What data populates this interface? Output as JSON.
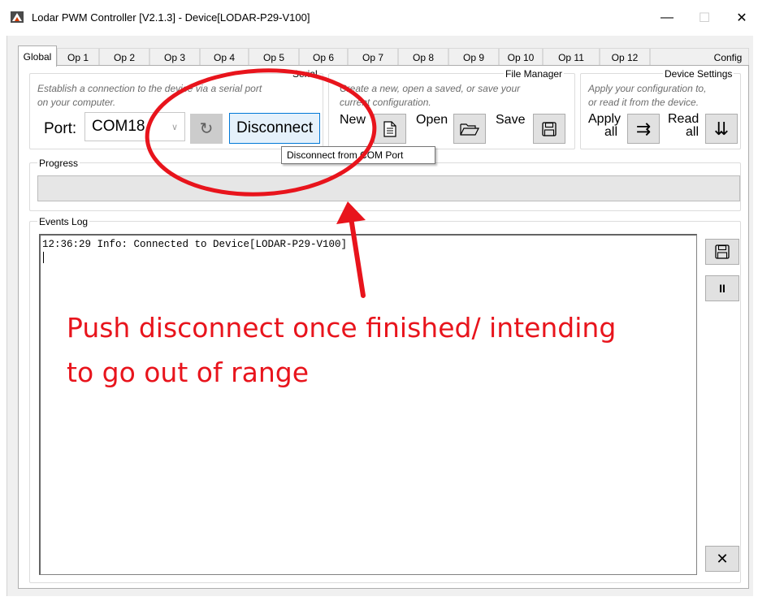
{
  "window": {
    "title": "Lodar PWM Controller [V2.1.3] - Device[LODAR-P29-V100]",
    "controls": {
      "minimize": "—",
      "maximize": "☐",
      "close": "✕"
    }
  },
  "tabs": [
    {
      "label": "Global",
      "active": true
    },
    {
      "label": "Op 1"
    },
    {
      "label": "Op 2"
    },
    {
      "label": "Op 3"
    },
    {
      "label": "Op 4"
    },
    {
      "label": "Op 5"
    },
    {
      "label": "Op 6"
    },
    {
      "label": "Op 7"
    },
    {
      "label": "Op 8"
    },
    {
      "label": "Op 9"
    },
    {
      "label": "Op 10"
    },
    {
      "label": "Op 11"
    },
    {
      "label": "Op 12"
    },
    {
      "label": "Config"
    }
  ],
  "serial": {
    "title": "Serial",
    "hint_line1": "Establish a connection to the device via a serial port",
    "hint_line2": "on your computer.",
    "port_label": "Port:",
    "port_value": "COM18",
    "refresh_glyph": "↻",
    "disconnect_label": "Disconnect"
  },
  "file_manager": {
    "title": "File Manager",
    "hint_line1": "Create a new, open a saved, or save your",
    "hint_line2": "current configuration.",
    "new_label": "New",
    "open_label": "Open",
    "save_label": "Save"
  },
  "device_settings": {
    "title": "Device Settings",
    "hint_line1": "Apply your configuration to,",
    "hint_line2": "or read it from the device.",
    "apply_label_1": "Apply",
    "apply_label_2": "all",
    "read_label_1": "Read",
    "read_label_2": "all",
    "apply_glyph": "⇉",
    "read_glyph": "⇊"
  },
  "tooltip": "Disconnect from COM Port",
  "progress": {
    "title": "Progress",
    "value": 0
  },
  "events_log": {
    "title": "Events Log",
    "lines": [
      "12:36:29 Info: Connected to Device[LODAR-P29-V100]"
    ],
    "pause_glyph": "II",
    "clear_glyph": "✕"
  },
  "annotation": {
    "line1": "Push disconnect once finished/ intending",
    "line2": "to go out of range",
    "color": "#e8141c"
  },
  "colors": {
    "accent": "#0078d7",
    "annotation_red": "#e8141c",
    "window_bg": "#f0f0f0"
  }
}
